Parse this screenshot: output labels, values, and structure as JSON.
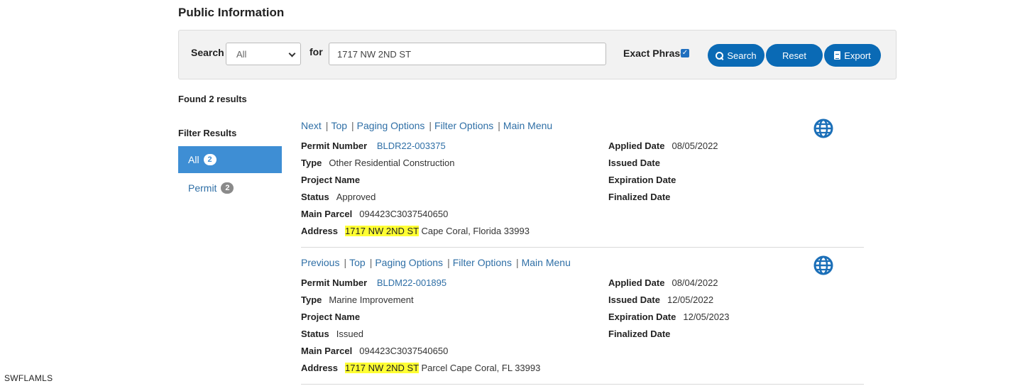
{
  "page": {
    "title": "Public Information"
  },
  "search": {
    "label": "Search",
    "scope_value": "All",
    "for_label": "for",
    "query_value": "1717 NW 2ND ST",
    "exact_phrase_label": "Exact Phrase",
    "exact_phrase_checked": true,
    "search_button": "Search",
    "reset_button": "Reset",
    "export_button": "Export"
  },
  "results": {
    "found_text": "Found 2 results"
  },
  "filters": {
    "title": "Filter Results",
    "items": [
      {
        "label": "All",
        "count": "2",
        "active": true
      },
      {
        "label": "Permit",
        "count": "2",
        "active": false
      }
    ]
  },
  "records": [
    {
      "nav": [
        "Next",
        "Top",
        "Paging Options",
        "Filter Options",
        "Main Menu"
      ],
      "permit_number_label": "Permit Number",
      "permit_number": "BLDR22-003375",
      "type_label": "Type",
      "type": "Other Residential Construction",
      "project_name_label": "Project Name",
      "status_label": "Status",
      "status": "Approved",
      "main_parcel_label": "Main Parcel",
      "main_parcel": "094423C3037540650",
      "address_label": "Address",
      "address_highlight": "1717 NW 2ND ST",
      "address_rest": "Cape Coral, Florida 33993",
      "applied_date_label": "Applied Date",
      "applied_date": "08/05/2022",
      "issued_date_label": "Issued Date",
      "issued_date": "",
      "expiration_date_label": "Expiration Date",
      "expiration_date": "",
      "finalized_date_label": "Finalized Date",
      "finalized_date": ""
    },
    {
      "nav": [
        "Previous",
        "Top",
        "Paging Options",
        "Filter Options",
        "Main Menu"
      ],
      "permit_number_label": "Permit Number",
      "permit_number": "BLDM22-001895",
      "type_label": "Type",
      "type": "Marine Improvement",
      "project_name_label": "Project Name",
      "status_label": "Status",
      "status": "Issued",
      "main_parcel_label": "Main Parcel",
      "main_parcel": "094423C3037540650",
      "address_label": "Address",
      "address_highlight": "1717 NW 2ND ST",
      "address_rest": "Parcel Cape Coral, FL 33993",
      "applied_date_label": "Applied Date",
      "applied_date": "08/04/2022",
      "issued_date_label": "Issued Date",
      "issued_date": "12/05/2022",
      "expiration_date_label": "Expiration Date",
      "expiration_date": "12/05/2023",
      "finalized_date_label": "Finalized Date",
      "finalized_date": ""
    }
  ],
  "watermark": "SWFLAMLS",
  "colors": {
    "primary_button": "#0a6ab5",
    "active_filter": "#3e8ed4",
    "link": "#2f6fa6",
    "highlight": "#ffff33"
  }
}
